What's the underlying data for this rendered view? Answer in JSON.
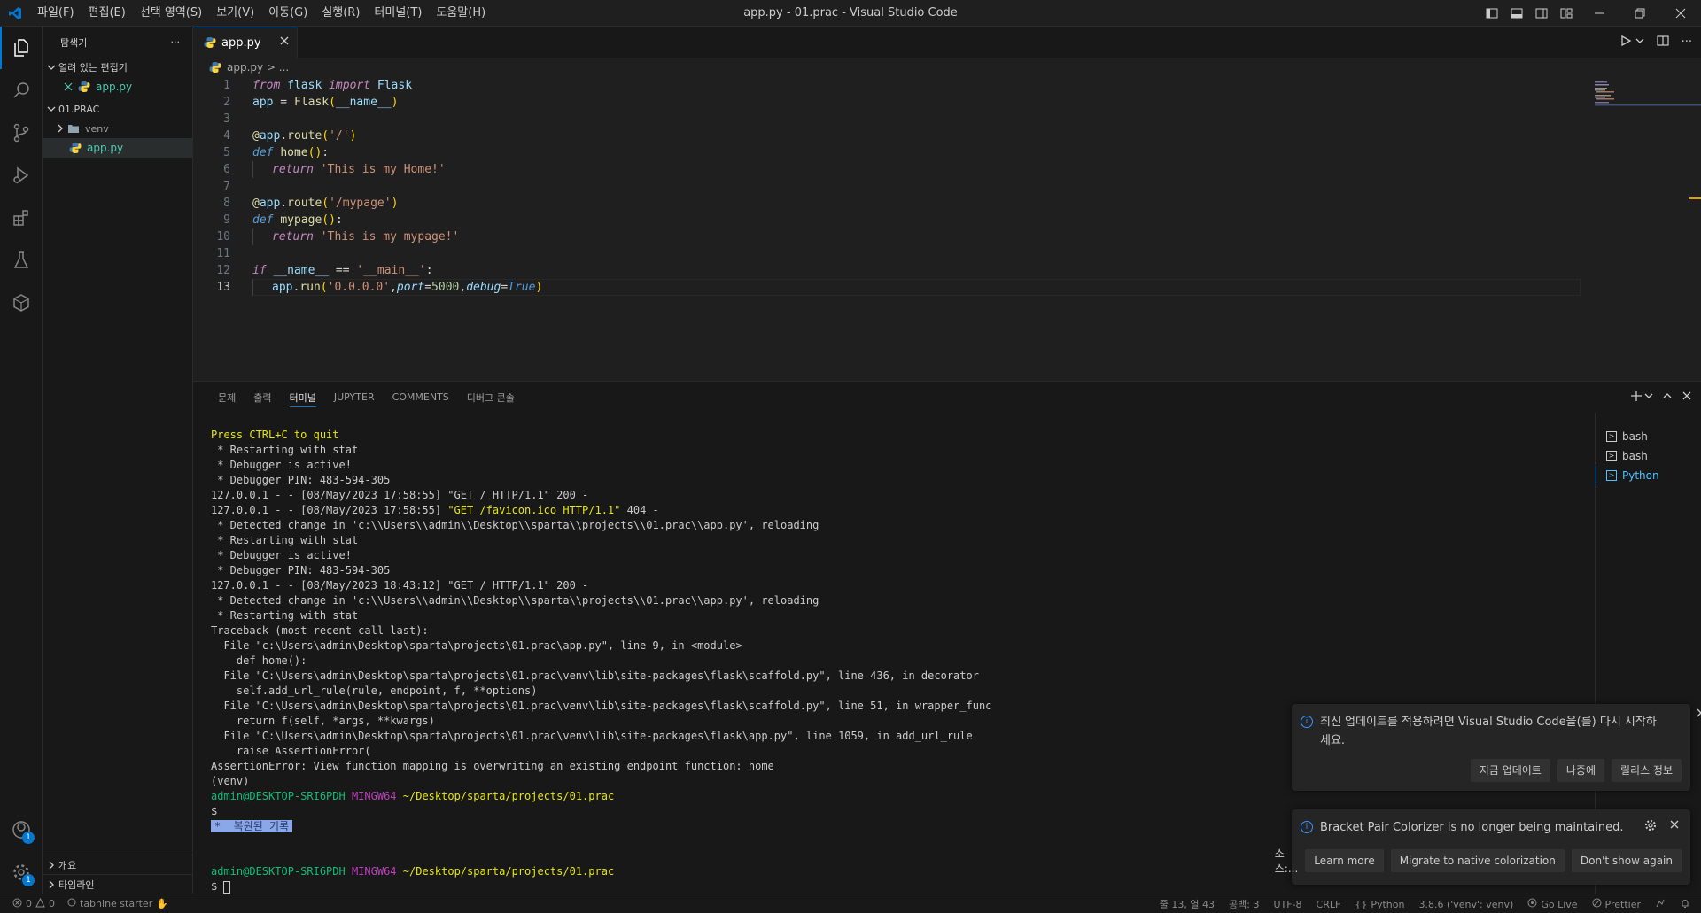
{
  "window": {
    "title": "app.py - 01.prac - Visual Studio Code",
    "menu": [
      "파일(F)",
      "편집(E)",
      "선택 영역(S)",
      "보기(V)",
      "이동(G)",
      "실행(R)",
      "터미널(T)",
      "도움말(H)"
    ]
  },
  "activity": {
    "accounts_badge": "1",
    "settings_badge": "1"
  },
  "sidebar": {
    "title": "탐색기",
    "more": "···",
    "open_editors": "열려 있는 편집기",
    "open_file": "app.py",
    "folder": "01.PRAC",
    "venv": "venv",
    "file": "app.py",
    "outline": "개요",
    "timeline": "타임라인"
  },
  "editor": {
    "tab": "app.py",
    "breadcrumb": "app.py > ...",
    "lines": [
      "1",
      "2",
      "3",
      "4",
      "5",
      "6",
      "7",
      "8",
      "9",
      "10",
      "11",
      "12",
      "13"
    ]
  },
  "panel": {
    "tabs": [
      "문제",
      "출력",
      "터미널",
      "JUPYTER",
      "COMMENTS",
      "디버그 콘솔"
    ],
    "active_tab": "터미널",
    "terminals": [
      "bash",
      "bash",
      "Python"
    ],
    "terminal_lines": [
      " * Restarting with stat",
      " * Debugger is active!",
      " * Debugger PIN: 483-594-305",
      "127.0.0.1 - - [08/May/2023 17:58:55] \"GET / HTTP/1.1\" 200 -",
      "127.0.0.1 - - [08/May/2023 17:58:55] ",
      " * Detected change in 'c:\\\\Users\\\\admin\\\\Desktop\\\\sparta\\\\projects\\\\01.prac\\\\app.py', reloading",
      " * Restarting with stat",
      " * Debugger is active!",
      " * Debugger PIN: 483-594-305",
      "127.0.0.1 - - [08/May/2023 18:43:12] \"GET / HTTP/1.1\" 200 -",
      " * Detected change in 'c:\\\\Users\\\\admin\\\\Desktop\\\\sparta\\\\projects\\\\01.prac\\\\app.py', reloading",
      " * Restarting with stat",
      "Traceback (most recent call last):",
      "  File \"c:\\Users\\admin\\Desktop\\sparta\\projects\\01.prac\\app.py\", line 9, in <module>",
      "    def home():",
      "  File \"C:\\Users\\admin\\Desktop\\sparta\\projects\\01.prac\\venv\\lib\\site-packages\\flask\\scaffold.py\", line 436, in decorator",
      "    self.add_url_rule(rule, endpoint, f, **options)",
      "  File \"C:\\Users\\admin\\Desktop\\sparta\\projects\\01.prac\\venv\\lib\\site-packages\\flask\\scaffold.py\", line 51, in wrapper_func",
      "    return f(self, *args, **kwargs)",
      "  File \"C:\\Users\\admin\\Desktop\\sparta\\projects\\01.prac\\venv\\lib\\site-packages\\flask\\app.py\", line 1059, in add_url_rule",
      "    raise AssertionError(",
      "AssertionError: View function mapping is overwriting an existing endpoint function: home",
      "(venv)"
    ],
    "quit_line": "Press CTRL+C to quit",
    "favicon_req": "\"GET /favicon.ico HTTP/1.1\"",
    "favicon_status": " 404 -",
    "prompt_user": "admin@DESKTOP-SRI6PDH",
    "prompt_env": "MINGW64",
    "prompt_path": "~/Desktop/sparta/projects/01.prac",
    "dollar": "$",
    "restored": "*  복원된 기록",
    "dollar2": "$ "
  },
  "notifications": {
    "update_msg": "최신 업데이트를 적용하려면 Visual Studio Code을(를) 다시 시작하세요.",
    "update_now": "지금 업데이트",
    "later": "나중에",
    "release_notes": "릴리스 정보",
    "bracket_msg": "Bracket Pair Colorizer is no longer being maintained.",
    "source": "소스:...",
    "learn_more": "Learn more",
    "migrate": "Migrate to native colorization",
    "dont_show": "Don't show again"
  },
  "status": {
    "errors": "0",
    "warnings": "0",
    "tabnine": "tabnine starter",
    "position": "줄 13, 열 43",
    "spaces": "공백: 3",
    "encoding": "UTF-8",
    "eol": "CRLF",
    "language": "Python",
    "interpreter": "3.8.6 ('venv': venv)",
    "golive": "Go Live",
    "prettier": "Prettier"
  },
  "colors": {
    "accent": "#0078d4",
    "background": "#1e1e1e"
  }
}
